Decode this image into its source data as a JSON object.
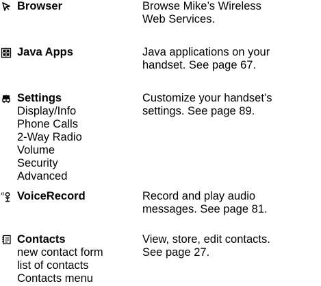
{
  "entries": [
    {
      "icon": "browser-icon",
      "title": "Browser",
      "subitems": [],
      "description_lines": [
        "Browse Mike’s Wireless",
        "Web Services."
      ]
    },
    {
      "icon": "java-apps-icon",
      "title": "Java Apps",
      "subitems": [],
      "description_lines": [
        "Java applications on your",
        "handset. See page 67."
      ]
    },
    {
      "icon": "settings-icon",
      "title": "Settings",
      "subitems": [
        "Display/Info",
        "Phone Calls",
        "2-Way Radio",
        "Volume",
        "Security",
        "Advanced"
      ],
      "description_lines": [
        "Customize your handset’s",
        "settings. See page 89."
      ]
    },
    {
      "icon": "voice-record-icon",
      "title": "VoiceRecord",
      "subitems": [],
      "description_lines": [
        "Record and play audio",
        "messages. See page 81."
      ]
    },
    {
      "icon": "contacts-icon",
      "title": "Contacts",
      "subitems": [
        "new contact form",
        "list of contacts",
        "Contacts menu"
      ],
      "description_lines": [
        "View, store, edit contacts.",
        "See page 27."
      ]
    }
  ]
}
